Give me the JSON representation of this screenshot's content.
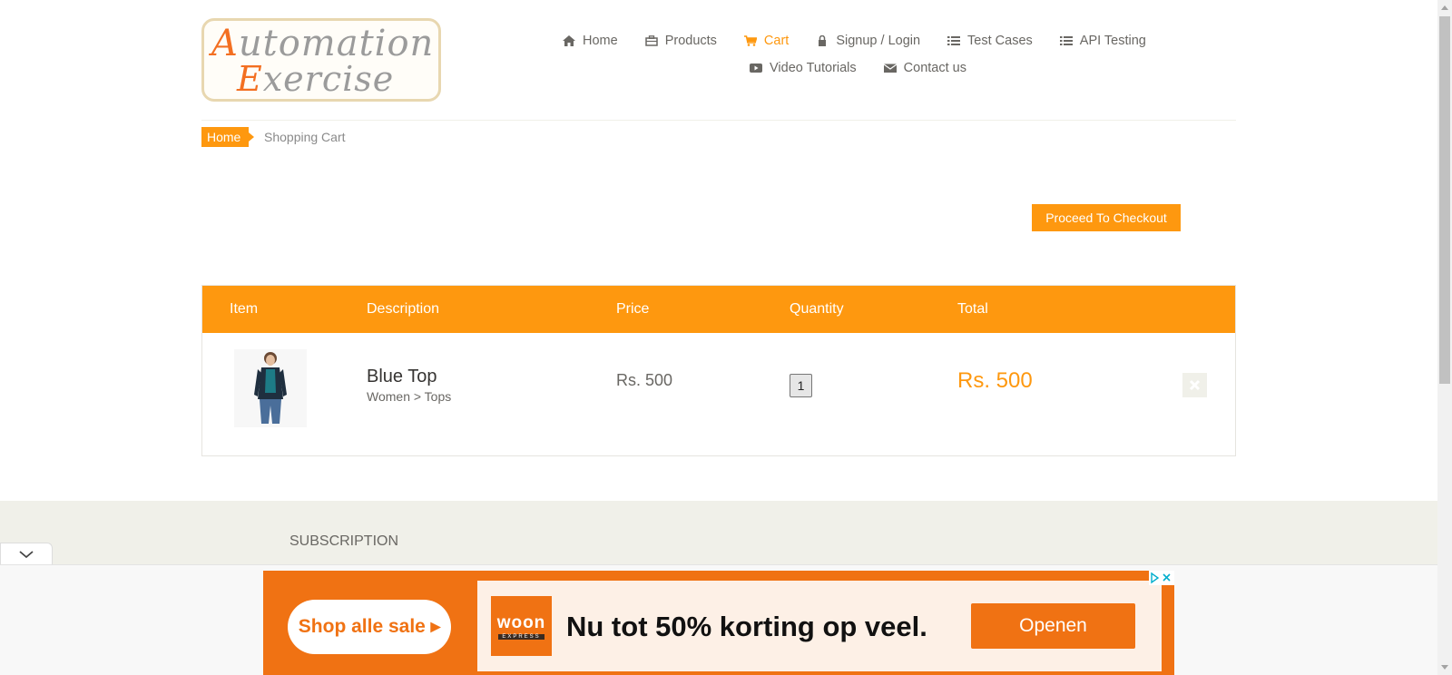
{
  "logo": {
    "line1_cap": "A",
    "line1_rest": "utomation",
    "line2_cap": "E",
    "line2_rest": "xercise"
  },
  "nav": {
    "items": [
      {
        "label": "Home",
        "icon": "home-icon"
      },
      {
        "label": "Products",
        "icon": "products-icon"
      },
      {
        "label": "Cart",
        "icon": "cart-icon",
        "active": true
      },
      {
        "label": "Signup / Login",
        "icon": "lock-icon"
      },
      {
        "label": "Test Cases",
        "icon": "list-icon"
      },
      {
        "label": "API Testing",
        "icon": "list-icon"
      },
      {
        "label": "Video Tutorials",
        "icon": "youtube-play-icon"
      },
      {
        "label": "Contact us",
        "icon": "envelope-icon"
      }
    ]
  },
  "breadcrumb": {
    "home": "Home",
    "current": "Shopping Cart"
  },
  "checkout_label": "Proceed To Checkout",
  "table": {
    "headers": {
      "item": "Item",
      "description": "Description",
      "price": "Price",
      "quantity": "Quantity",
      "total": "Total"
    },
    "rows": [
      {
        "name": "Blue Top",
        "category": "Women > Tops",
        "price": "Rs. 500",
        "quantity": "1",
        "total": "Rs. 500"
      }
    ]
  },
  "footer": {
    "subscription_title": "SUBSCRIPTION"
  },
  "ad": {
    "shop_label": "Shop alle sale ▸",
    "brand": "woon",
    "brand_sub": "EXPRESS",
    "headline": "Nu tot 50% korting op veel.",
    "open_label": "Openen"
  },
  "colors": {
    "accent": "#fe980f",
    "ad_orange": "#f07213",
    "footer_bg": "#f0f0e9"
  }
}
